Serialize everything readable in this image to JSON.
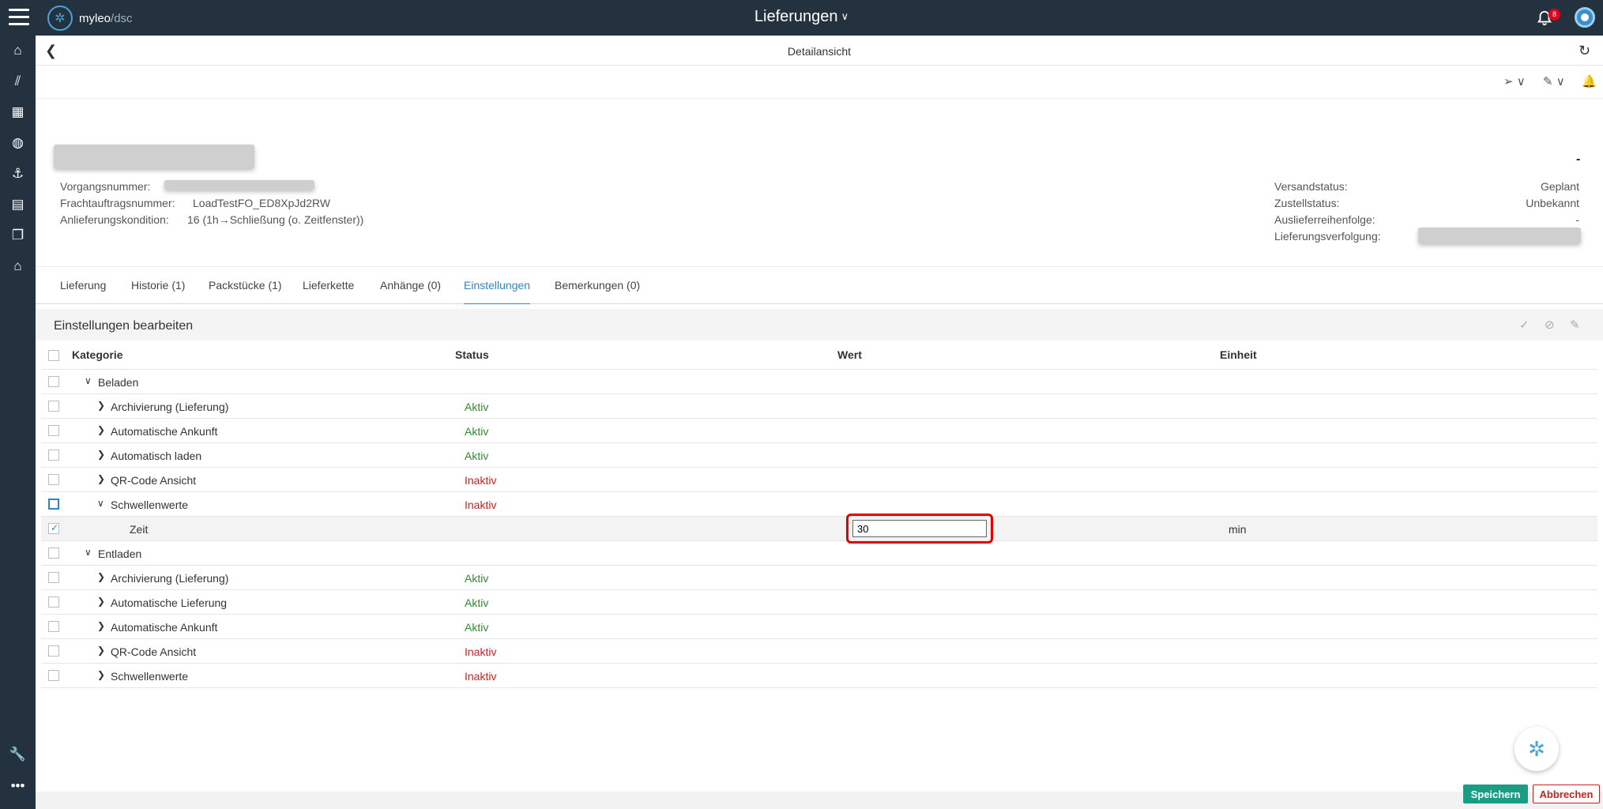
{
  "app": {
    "logo_main": "myleo",
    "logo_sep": "/",
    "logo_sub": "dsc",
    "title": "Lieferungen",
    "notification_count": "8"
  },
  "subheader": {
    "title": "Detailansicht"
  },
  "info": {
    "left": [
      {
        "label": "Vorgangsnummer:",
        "value": ""
      },
      {
        "label": "Frachtauftragsnummer:",
        "value": "LoadTestFO_ED8XpJd2RW"
      },
      {
        "label": "Anlieferungskondition:",
        "value": "16 (1h→Schließung (o. Zeitfenster))"
      }
    ],
    "top_right_value": "-",
    "right": [
      {
        "label": "Versandstatus:",
        "value": "Geplant"
      },
      {
        "label": "Zustellstatus:",
        "value": "Unbekannt"
      },
      {
        "label": "Auslieferreihenfolge:",
        "value": "-"
      },
      {
        "label": "Lieferungsverfolgung:",
        "value": ""
      }
    ]
  },
  "tabs": [
    "Lieferung",
    "Historie (1)",
    "Packstücke (1)",
    "Lieferkette",
    "Anhänge (0)",
    "Einstellungen",
    "Bemerkungen (0)"
  ],
  "settings": {
    "title": "Einstellungen bearbeiten",
    "columns": {
      "category": "Kategorie",
      "status": "Status",
      "value": "Wert",
      "unit": "Einheit"
    },
    "groups": [
      {
        "name": "Beladen",
        "items": [
          {
            "name": "Archivierung (Lieferung)",
            "status": "Aktiv"
          },
          {
            "name": "Automatische Ankunft",
            "status": "Aktiv"
          },
          {
            "name": "Automatisch laden",
            "status": "Aktiv"
          },
          {
            "name": "QR-Code Ansicht",
            "status": "Inaktiv"
          },
          {
            "name": "Schwellenwerte",
            "status": "Inaktiv"
          }
        ],
        "sub_item": {
          "name": "Zeit",
          "value": "30",
          "unit": "min"
        }
      },
      {
        "name": "Entladen",
        "items": [
          {
            "name": "Archivierung (Lieferung)",
            "status": "Aktiv"
          },
          {
            "name": "Automatische Lieferung",
            "status": "Aktiv"
          },
          {
            "name": "Automatische Ankunft",
            "status": "Aktiv"
          },
          {
            "name": "QR-Code Ansicht",
            "status": "Inaktiv"
          },
          {
            "name": "Schwellenwerte",
            "status": "Inaktiv"
          }
        ]
      }
    ]
  },
  "actions": {
    "save": "Speichern",
    "cancel": "Abbrechen"
  },
  "colors": {
    "topbar": "#243240",
    "accent": "#2d86c9",
    "active": "#2e8b2e",
    "inactive": "#d11c1c",
    "save": "#1b9c85"
  }
}
